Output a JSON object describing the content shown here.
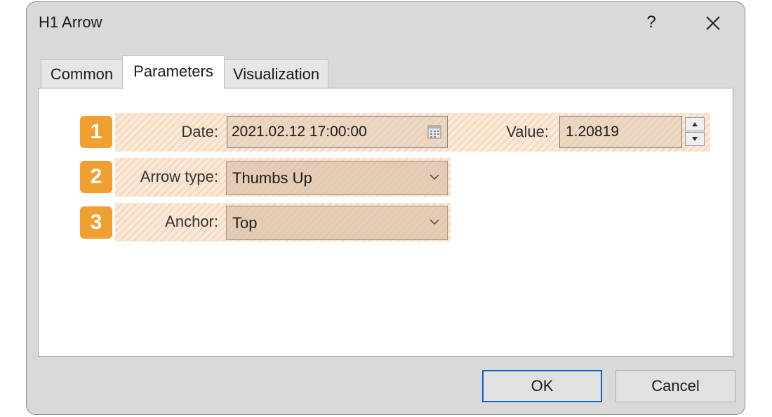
{
  "window": {
    "title": "H1 Arrow",
    "help_label": "?",
    "close_icon": "close-icon"
  },
  "tabs": [
    {
      "label": "Common",
      "active": false
    },
    {
      "label": "Parameters",
      "active": true
    },
    {
      "label": "Visualization",
      "active": false
    }
  ],
  "params": {
    "date": {
      "badge": "1",
      "label": "Date:",
      "value": "2021.02.12 17:00:00",
      "icon": "calendar-icon"
    },
    "value": {
      "label": "Value:",
      "value": "1.20819"
    },
    "arrow_type": {
      "badge": "2",
      "label": "Arrow type:",
      "value": "Thumbs Up"
    },
    "anchor": {
      "badge": "3",
      "label": "Anchor:",
      "value": "Top"
    }
  },
  "footer": {
    "ok_label": "OK",
    "cancel_label": "Cancel"
  },
  "colors": {
    "badge": "#f0a030",
    "highlight": "#fbe8d8",
    "default_button_border": "#0a64c8"
  }
}
